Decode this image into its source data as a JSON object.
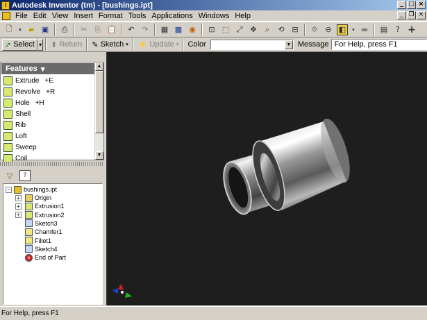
{
  "window": {
    "title": "Autodesk Inventor (tm) - [bushings.ipt]"
  },
  "menu": [
    "File",
    "Edit",
    "View",
    "Insert",
    "Format",
    "Tools",
    "Applications",
    "Windows",
    "Help"
  ],
  "command_bar": {
    "select_label": "Select",
    "return_label": "Return",
    "sketch_label": "Sketch",
    "update_label": "Update",
    "color_label": "Color",
    "color_value": "",
    "message_label": "Message",
    "message_value": "For Help, press F1"
  },
  "features_panel": {
    "title": "Features",
    "items": [
      {
        "label": "Extrude",
        "shortcut": "+E",
        "icon": "extrude-icon"
      },
      {
        "label": "Revolve",
        "shortcut": "+R",
        "icon": "revolve-icon"
      },
      {
        "label": "Hole",
        "shortcut": "+H",
        "icon": "hole-icon"
      },
      {
        "label": "Shell",
        "shortcut": "",
        "icon": "shell-icon"
      },
      {
        "label": "Rib",
        "shortcut": "",
        "icon": "rib-icon"
      },
      {
        "label": "Loft",
        "shortcut": "",
        "icon": "loft-icon"
      },
      {
        "label": "Sweep",
        "shortcut": "",
        "icon": "sweep-icon"
      },
      {
        "label": "Coil",
        "shortcut": "",
        "icon": "coil-icon"
      }
    ]
  },
  "browser": {
    "root": "bushings.ipt",
    "nodes": [
      {
        "label": "Origin",
        "icon": "folder-icon",
        "expandable": true
      },
      {
        "label": "Extrusion1",
        "icon": "extrude-icon",
        "expandable": true
      },
      {
        "label": "Extrusion2",
        "icon": "extrude-icon",
        "expandable": true
      },
      {
        "label": "Sketch3",
        "icon": "sketch-icon",
        "expandable": false
      },
      {
        "label": "Chamfer1",
        "icon": "chamfer-icon",
        "expandable": false
      },
      {
        "label": "Fillet1",
        "icon": "fillet-icon",
        "expandable": false
      },
      {
        "label": "Sketch4",
        "icon": "sketch-icon",
        "expandable": false
      },
      {
        "label": "End of Part",
        "icon": "end-of-part-icon",
        "expandable": false
      }
    ]
  },
  "status": {
    "text": "For Help, press F1"
  },
  "colors": {
    "viewport_bg": "#1e1e1e",
    "title_start": "#0a246a",
    "title_end": "#a6caf0",
    "end_of_part": "#d02020"
  }
}
